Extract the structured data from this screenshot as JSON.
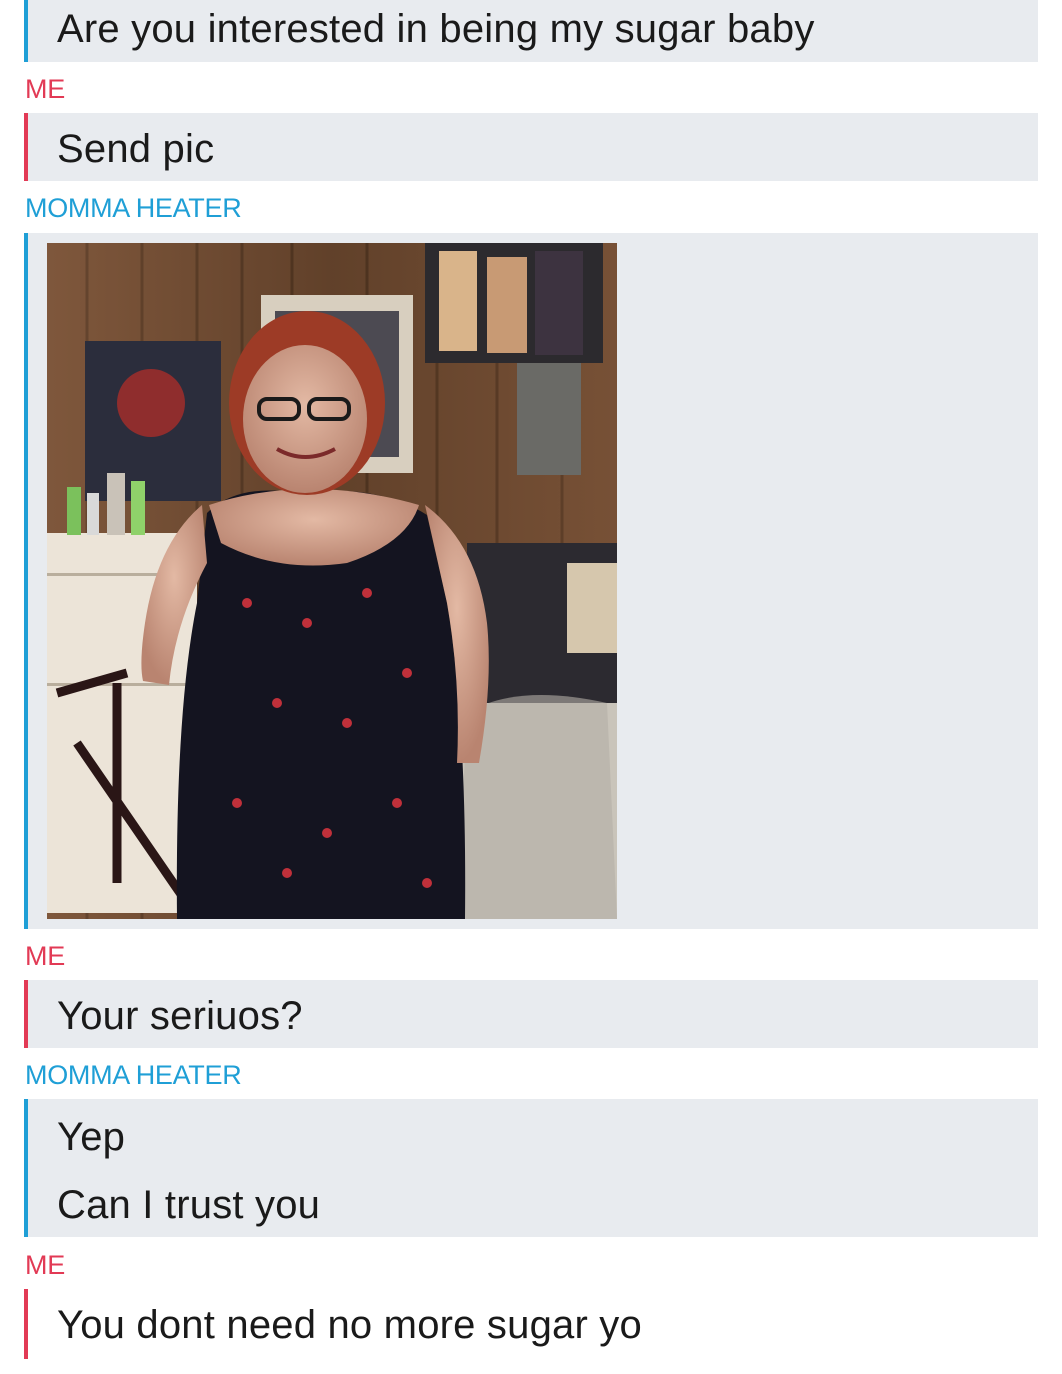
{
  "conversation": {
    "messages": [
      {
        "sender": "",
        "text": "Are you interested in being my sugar baby",
        "side": "them"
      },
      {
        "sender": "ME",
        "text": "Send pic",
        "side": "me"
      },
      {
        "sender": "MOMMA HEATER",
        "attachment": "photo",
        "side": "them"
      },
      {
        "sender": "ME",
        "text": "Your seriuos?",
        "side": "me"
      },
      {
        "sender": "MOMMA HEATER",
        "texts": [
          "Yep",
          "Can I trust you"
        ],
        "side": "them"
      },
      {
        "sender": "ME",
        "text": "You dont need no more sugar yo",
        "side": "me"
      }
    ]
  },
  "colors": {
    "me": "#e23a55",
    "them": "#1f9fd6",
    "bubble_bg": "#e8ebef"
  }
}
